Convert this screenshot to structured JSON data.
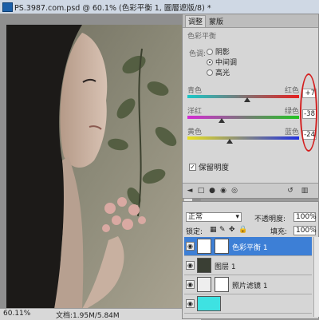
{
  "document": {
    "title": "PS.3987.com.psd @ 60.1% (色彩平衡 1, 圖層遮版/8) *",
    "status_zoom": "60.11%",
    "status_doc": "文档:1.95M/5.84M"
  },
  "adjustments": {
    "tabs": [
      "调整",
      "蒙版"
    ],
    "title": "色彩平衡",
    "tone_label": "色调:",
    "tones": [
      {
        "label": "阴影",
        "selected": false
      },
      {
        "label": "中间调",
        "selected": true
      },
      {
        "label": "高光",
        "selected": false
      }
    ],
    "sliders": [
      {
        "left": "青色",
        "right": "红色",
        "value": "+7",
        "level": 7,
        "colors": [
          "#19c8c8",
          "#e52020"
        ]
      },
      {
        "left": "洋红",
        "right": "绿色",
        "value": "-38",
        "level": -38,
        "colors": [
          "#d42ad4",
          "#22c422"
        ]
      },
      {
        "left": "黄色",
        "right": "蓝色",
        "value": "-24",
        "level": -24,
        "colors": [
          "#e8e020",
          "#2030e0"
        ]
      }
    ],
    "preserve_luminosity": {
      "label": "保留明度",
      "checked": true
    },
    "highlight_color": "#d42020"
  },
  "layers": {
    "blend_mode": "正常",
    "opacity_label": "不透明度:",
    "opacity_value": "100%",
    "lock_label": "锁定:",
    "fill_label": "填充:",
    "fill_value": "100%",
    "items": [
      {
        "name": "色彩平衡 1",
        "selected": true,
        "thumb": "adjustment-icon"
      },
      {
        "name": "图层 1",
        "selected": false,
        "thumb": "photo-thumbnail"
      },
      {
        "name": "照片滤镜 1",
        "selected": false,
        "thumb": "adjustment-icon"
      },
      {
        "name": "",
        "selected": false,
        "thumb": "cyan-fill"
      }
    ],
    "selected_color": "#3d7fd6"
  }
}
